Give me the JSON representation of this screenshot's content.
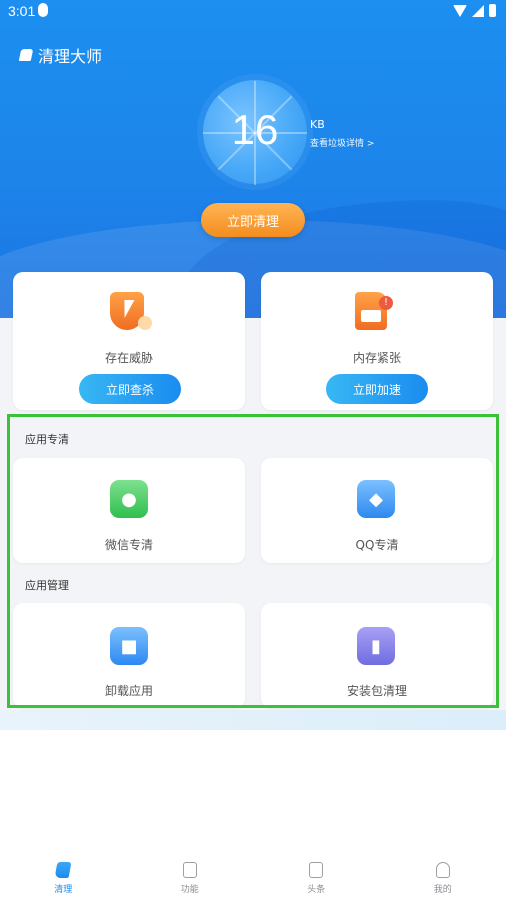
{
  "status_bar": {
    "time": "3:01"
  },
  "header": {
    "title": "清理大师"
  },
  "gauge": {
    "value": "16",
    "unit": "KB",
    "detail_link": "查看垃圾详情 >"
  },
  "primary_action": {
    "label": "立即清理"
  },
  "cards": [
    {
      "label": "存在威胁",
      "button": "立即查杀"
    },
    {
      "label": "内存紧张",
      "button": "立即加速"
    }
  ],
  "sections": [
    {
      "title": "应用专清",
      "items": [
        {
          "label": "微信专清",
          "icon": "wechat-icon"
        },
        {
          "label": "QQ专清",
          "icon": "qq-icon"
        }
      ]
    },
    {
      "title": "应用管理",
      "items": [
        {
          "label": "卸载应用",
          "icon": "android-icon"
        },
        {
          "label": "安装包清理",
          "icon": "trash-icon"
        }
      ]
    }
  ],
  "bottom_nav": [
    {
      "label": "清理",
      "icon": "brush-icon",
      "active": true
    },
    {
      "label": "功能",
      "icon": "phone-icon"
    },
    {
      "label": "头条",
      "icon": "news-icon"
    },
    {
      "label": "我的",
      "icon": "user-icon"
    }
  ],
  "colors": {
    "primary_blue": "#1c8ff0",
    "accent_orange": "#f48d1e",
    "highlight_green": "#3cc23a"
  }
}
